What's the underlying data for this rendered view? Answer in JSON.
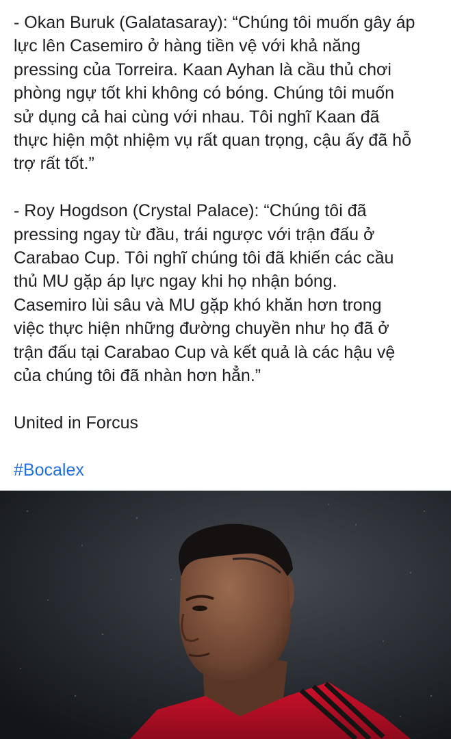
{
  "post": {
    "paragraphs": [
      {
        "lines": [
          "- Okan Buruk (Galatasaray): “Chúng tôi muốn gây áp",
          "lực lên Casemiro ở hàng tiền vệ với khả năng",
          "pressing của Torreira. Kaan Ayhan là cầu thủ chơi",
          "phòng ngự tốt khi không có bóng. Chúng tôi muốn",
          "sử dụng cả hai cùng với nhau. Tôi nghĩ Kaan đã",
          "thực hiện một nhiệm vụ rất quan trọng, cậu ấy đã hỗ",
          "trợ rất tốt.”"
        ]
      },
      {
        "lines": [
          "- Roy Hogdson (Crystal Palace): “Chúng tôi đã",
          "pressing ngay từ đầu, trái ngược với trận đấu ở",
          "Carabao Cup. Tôi nghĩ chúng tôi đã khiến các cầu",
          "thủ MU gặp áp lực ngay khi họ nhận bóng.",
          "Casemiro lùi sâu và MU gặp khó khăn hơn trong",
          "việc thực hiện những đường chuyền như họ đã ở",
          "trận đấu tại Carabao Cup và kết quả là các hậu vệ",
          "của chúng tôi đã nhàn hơn hẳn.”"
        ]
      },
      {
        "lines": [
          "United in Forcus"
        ]
      }
    ],
    "hashtag": "#Bocalex",
    "hashtag_color": "#216fdb",
    "text_color": "#1c1e21"
  },
  "photo": {
    "subject": "football-player-portrait",
    "kit_color": "#c8102e"
  }
}
